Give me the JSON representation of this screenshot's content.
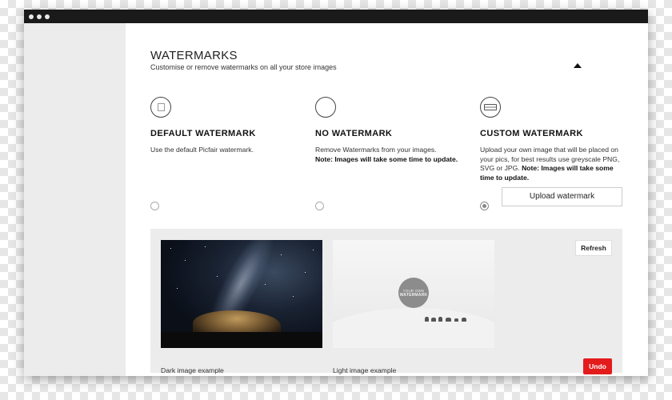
{
  "window": {
    "dots": [
      "",
      "",
      ""
    ]
  },
  "watermarks": {
    "title": "WATERMARKS",
    "subtitle": "Customise or remove watermarks on all your store images",
    "collapse_icon": "caret-up-icon"
  },
  "options": [
    {
      "icon": "picture-icon",
      "title": "DEFAULT WATERMARK",
      "description": "Use the default Picfair watermark.",
      "selected": false
    },
    {
      "icon": "empty-circle-icon",
      "title": "NO WATERMARK",
      "description": "Remove Watermarks from your images.",
      "note": "Note: Images will take some time to update.",
      "selected": false
    },
    {
      "icon": "custom-watermark-icon",
      "title": "CUSTOM WATERMARK",
      "description": "Upload your own image that will be placed on your pics, for best results use greyscale PNG, SVG or JPG.",
      "note": "Note: Images will take some time to update.",
      "selected": true,
      "upload_label": "Upload watermark"
    }
  ],
  "preview": {
    "refresh_label": "Refresh",
    "undo_label": "Undo",
    "dark_caption": "Dark image example",
    "light_caption": "Light image example",
    "watermark_line1": "YOUR OWN",
    "watermark_line2": "WATERMARK"
  },
  "colors": {
    "undo": "#e41b1b",
    "sidebar": "#ececec",
    "panel": "#ececec",
    "titlebar": "#1a1a1a"
  }
}
